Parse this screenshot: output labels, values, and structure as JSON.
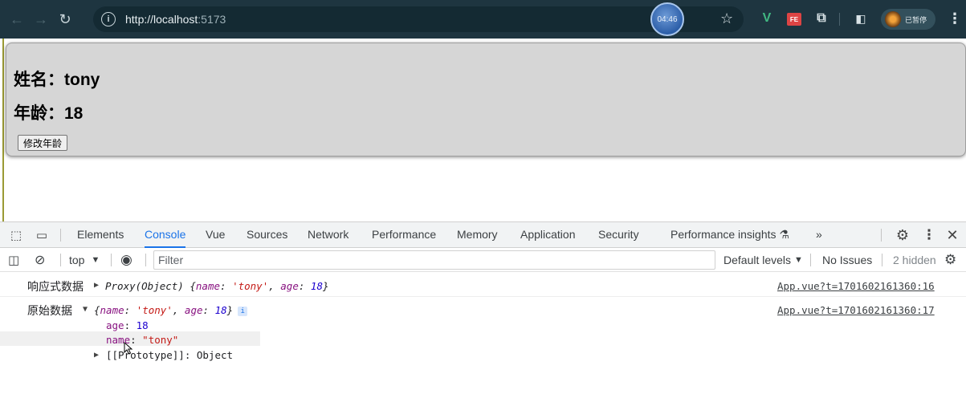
{
  "browser": {
    "url_host": "http://localhost",
    "url_port": ":5173",
    "timer": "04:46",
    "ext_fe": "FE",
    "profile_label": "已暂停"
  },
  "page": {
    "name_line": "姓名：tony",
    "age_line": "年龄：18",
    "button_label": "修改年龄"
  },
  "devtools": {
    "tabs": [
      "Elements",
      "Console",
      "Vue",
      "Sources",
      "Network",
      "Performance",
      "Memory",
      "Application",
      "Security",
      "Performance insights"
    ],
    "active_tab": "Console",
    "more_tabs": "»",
    "context": "top",
    "filter_placeholder": "Filter",
    "default_levels": "Default levels",
    "no_issues": "No Issues",
    "hidden": "2 hidden"
  },
  "console": {
    "row1": {
      "label": "响应式数据",
      "prefix": "Proxy(Object) {",
      "k1": "name",
      "v1": "'tony'",
      "k2": "age",
      "v2": "18",
      "suffix": "}",
      "source": "App.vue?t=1701602161360:16"
    },
    "row2": {
      "label": "原始数据",
      "prefix": "{",
      "k1": "name",
      "v1": "'tony'",
      "k2": "age",
      "v2": "18",
      "suffix": "}",
      "info": "i",
      "source": "App.vue?t=1701602161360:17",
      "props": [
        {
          "key": "age",
          "value": "18"
        },
        {
          "key": "name",
          "value": "\"tony\""
        }
      ],
      "prototype": "[[Prototype]]: Object"
    }
  }
}
